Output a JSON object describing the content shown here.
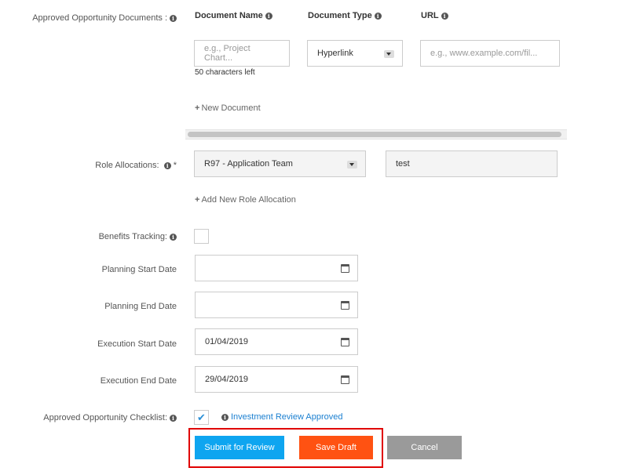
{
  "documents": {
    "label": "Approved Opportunity Documents :",
    "columns": {
      "name": "Document Name",
      "type": "Document Type",
      "url": "URL"
    },
    "name_placeholder": "e.g., Project Chart...",
    "type_value": "Hyperlink",
    "url_placeholder": "e.g., www.example.com/fil...",
    "chars_left": "50 characters left",
    "new_document": "New Document"
  },
  "roles": {
    "label": "Role Allocations:",
    "required": "*",
    "team_value": "R97 - Application Team",
    "text_value": "test",
    "add_label": "Add New Role Allocation"
  },
  "benefits": {
    "label": "Benefits Tracking:"
  },
  "dates": {
    "planning_start_label": "Planning Start Date",
    "planning_start_value": "",
    "planning_end_label": "Planning End Date",
    "planning_end_value": "",
    "execution_start_label": "Execution Start Date",
    "execution_start_value": "01/04/2019",
    "execution_end_label": "Execution End Date",
    "execution_end_value": "29/04/2019"
  },
  "checklist": {
    "label": "Approved Opportunity Checklist:",
    "item": "Investment Review Approved",
    "checked": true
  },
  "actions": {
    "submit": "Submit for Review",
    "save": "Save Draft",
    "cancel": "Cancel"
  },
  "icons": {
    "info": "info-icon",
    "calendar": "calendar-icon",
    "dropdown": "chevron-down-icon",
    "check": "checkmark-icon",
    "plus": "plus-icon"
  },
  "colors": {
    "submit": "#0ea5f0",
    "save": "#ff5212",
    "cancel": "#9a9a9a",
    "highlight": "#e00000",
    "link": "#1a7fd0"
  }
}
